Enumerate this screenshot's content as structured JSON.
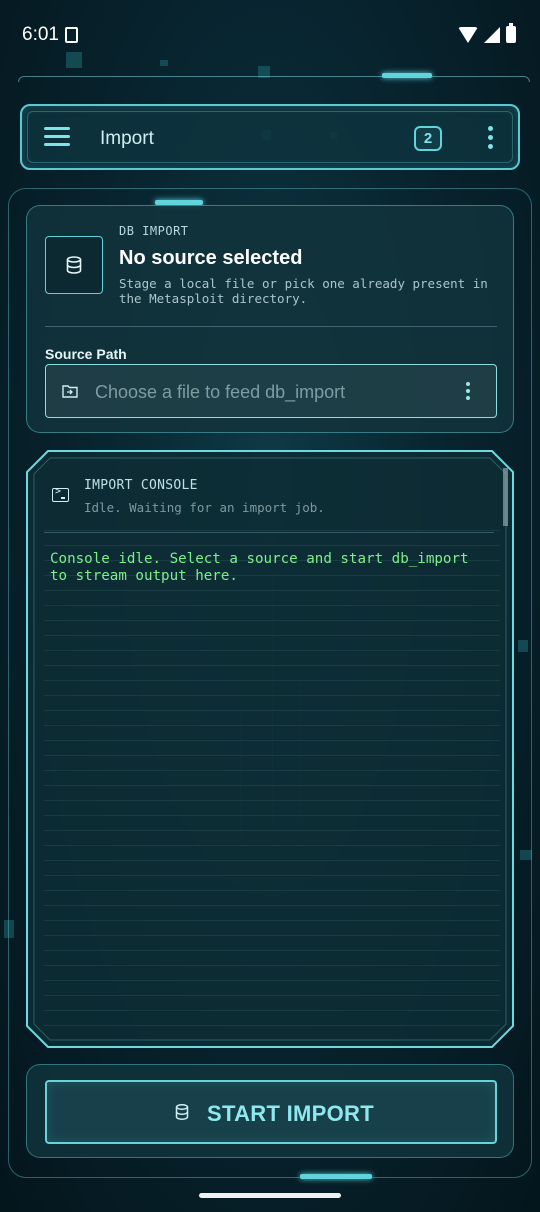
{
  "status_bar": {
    "time": "6:01",
    "icons": [
      "sim-card-icon",
      "wifi-icon",
      "signal-icon",
      "battery-icon"
    ]
  },
  "app_bar": {
    "title": "Import",
    "badge_count": "2",
    "icons": [
      "menu-icon",
      "more-vert-icon"
    ]
  },
  "db_import": {
    "eyebrow": "DB IMPORT",
    "title": "No source selected",
    "description": "Stage a local file or pick one already present in the Metasploit directory.",
    "source_label": "Source Path",
    "source_placeholder": "Choose a file to feed db_import",
    "icons": [
      "database-icon",
      "folder-icon",
      "more-vert-icon"
    ]
  },
  "console": {
    "title": "IMPORT CONSOLE",
    "status": "Idle. Waiting for an import job.",
    "output": "Console idle. Select a source and start db_import to stream output here.",
    "icons": [
      "terminal-icon"
    ]
  },
  "action": {
    "start_label": "START IMPORT",
    "icons": [
      "database-icon"
    ]
  },
  "colors": {
    "accent": "#5fd4dc",
    "console_text": "#7df08a",
    "background": "#082530"
  }
}
